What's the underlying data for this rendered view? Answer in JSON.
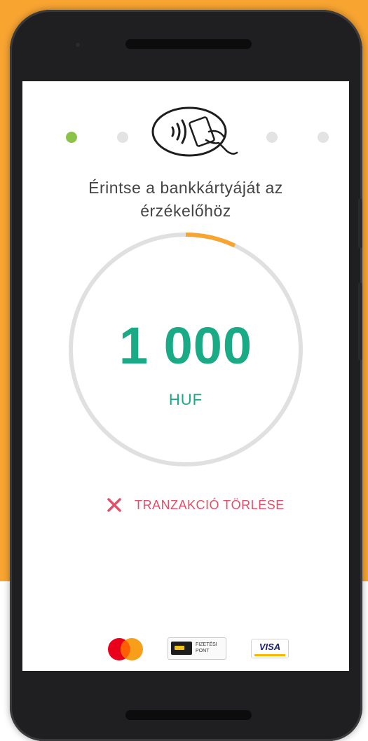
{
  "steps": {
    "count": 5,
    "active_index": 0
  },
  "instruction": {
    "line1": "Érintse a bankkártyáját az",
    "line2": "érzékelőhöz"
  },
  "payment": {
    "amount": "1 000",
    "currency": "HUF",
    "timer_progress": 0.07
  },
  "cancel": {
    "label": "TRANZAKCIÓ TÖRLÉSE"
  },
  "logos": {
    "fizetesi_pont_line1": "FIZETÉSI",
    "fizetesi_pont_line2": "PONT",
    "visa": "VISA"
  },
  "colors": {
    "background": "#f7a431",
    "accent": "#1aab86",
    "step_active": "#8bc34a",
    "step_inactive": "#e3e3e3",
    "progress": "#f7a431",
    "ring": "#e0e0e0",
    "cancel": "#e0506a"
  },
  "icons": {
    "cancel": "close-icon",
    "nfc": "contactless-card-icon"
  }
}
